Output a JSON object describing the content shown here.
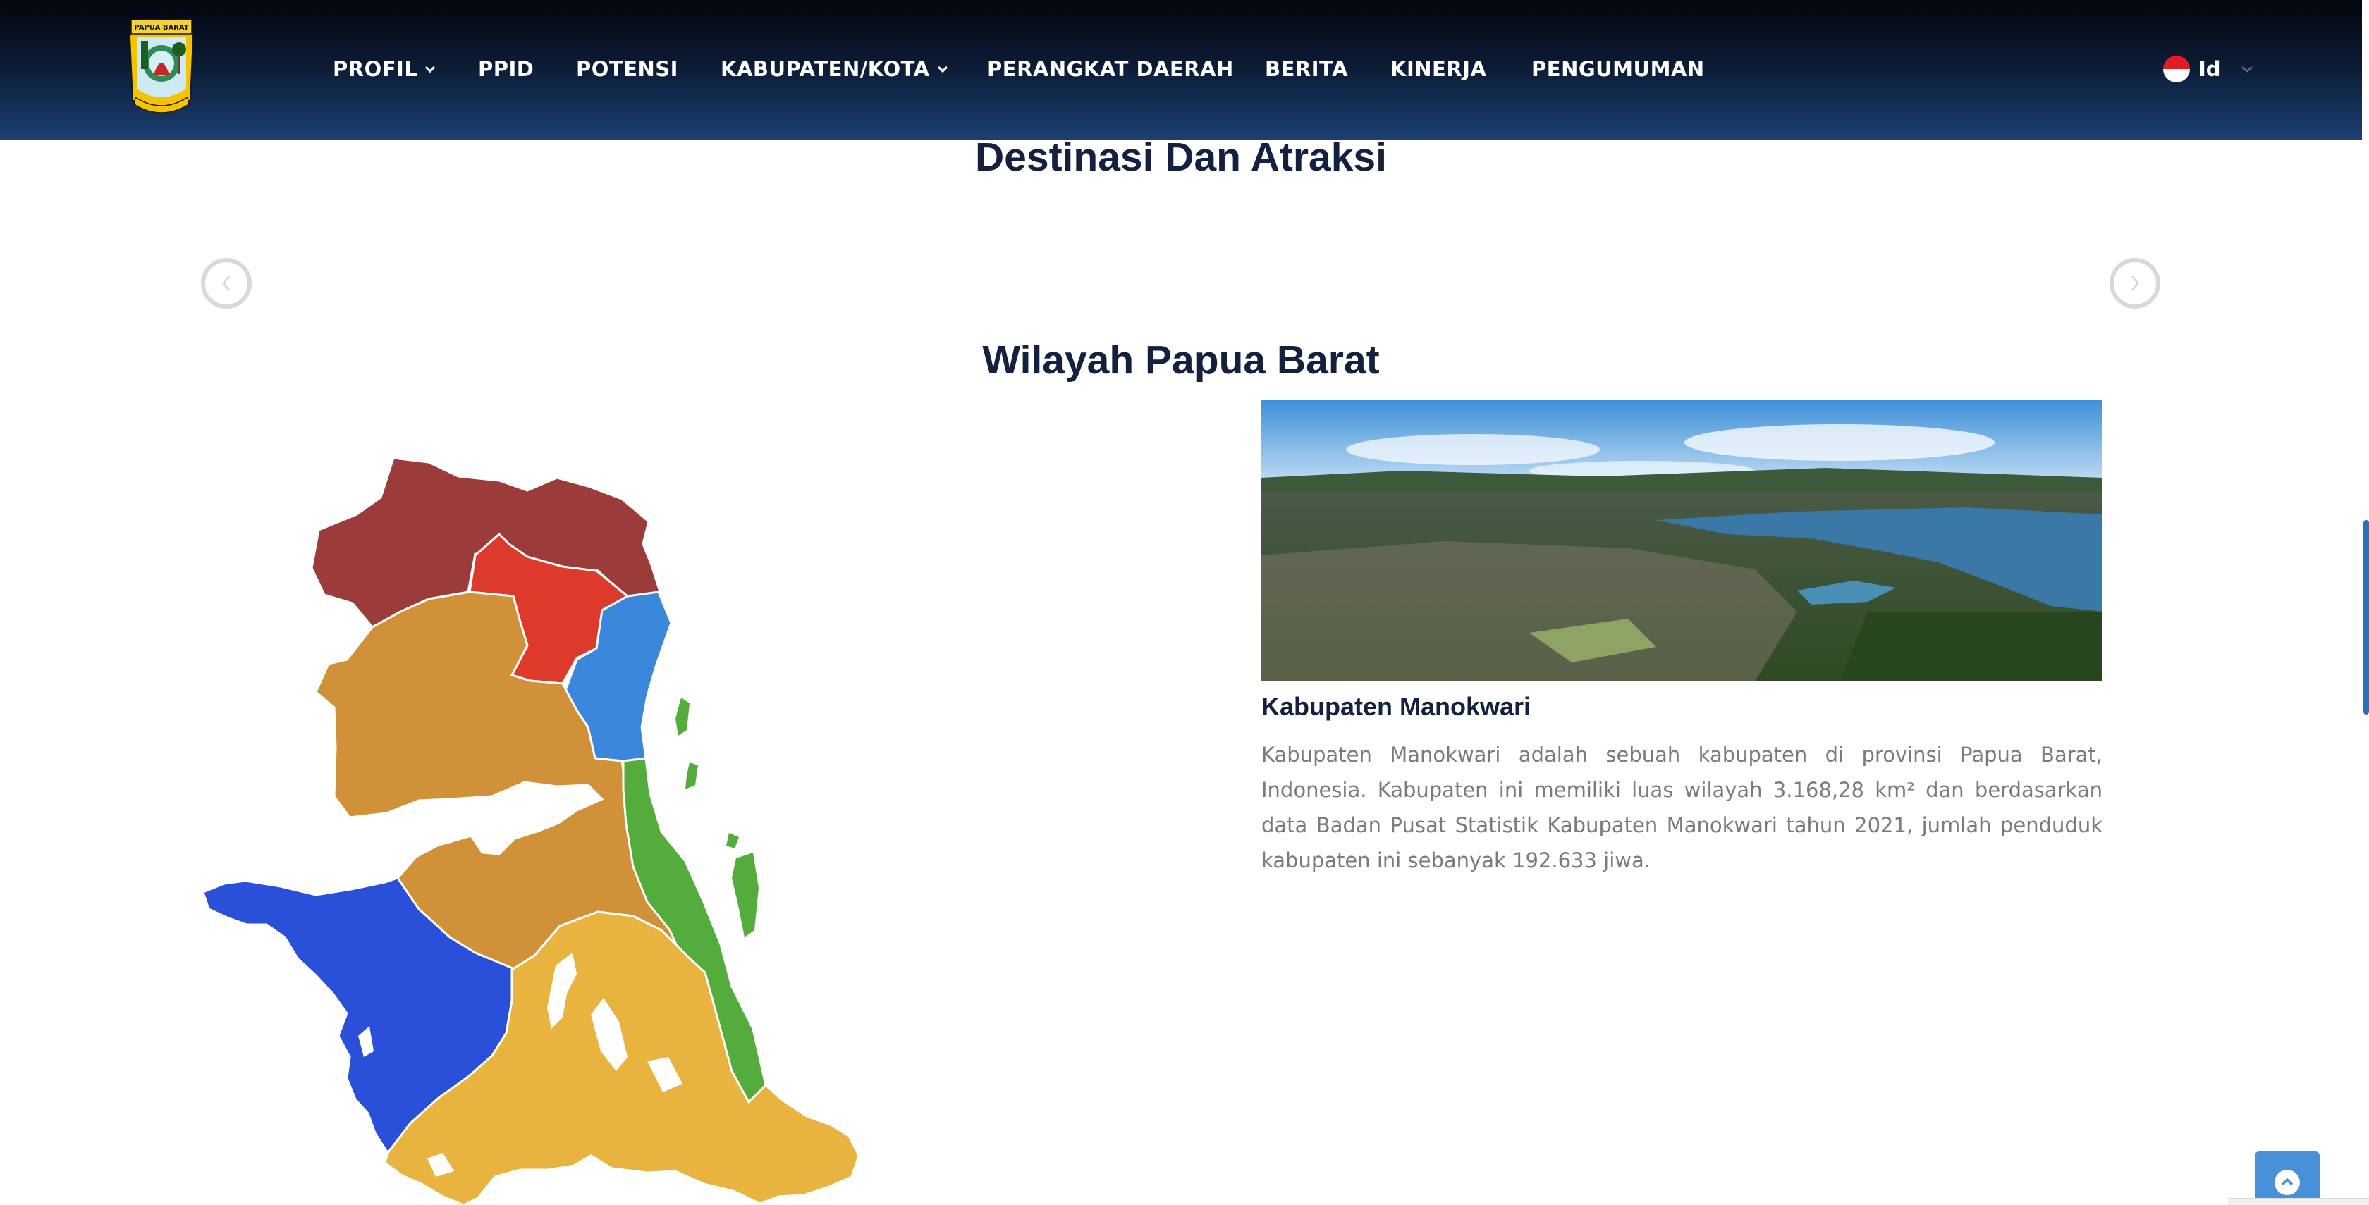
{
  "header": {
    "logo": {
      "icon": "papua-barat-emblem",
      "banner_text": "PAPUA BARAT"
    },
    "nav": [
      {
        "label": "PROFIL",
        "has_dropdown": true
      },
      {
        "label": "PPID",
        "has_dropdown": false
      },
      {
        "label": "POTENSI",
        "has_dropdown": false
      },
      {
        "label": "KABUPATEN/KOTA",
        "has_dropdown": true
      },
      {
        "label": "PERANGKAT DAERAH",
        "has_dropdown": false
      },
      {
        "label": "BERITA",
        "has_dropdown": false
      },
      {
        "label": "KINERJA",
        "has_dropdown": false
      },
      {
        "label": "PENGUMUMAN",
        "has_dropdown": false
      }
    ],
    "language": {
      "label": "Id",
      "icon": "indonesia-flag-icon"
    }
  },
  "destinations": {
    "title": "Destinasi Dan Atraksi",
    "prev_icon": "chevron-left-icon",
    "next_icon": "chevron-right-icon"
  },
  "region": {
    "title": "Wilayah Papua Barat",
    "map_icon": "papua-barat-region-map",
    "map_colors": [
      "#9b3c3a",
      "#de3a2b",
      "#3b87db",
      "#d09139",
      "#53ac3c",
      "#2a4fd9",
      "#e8b33f"
    ],
    "selected": {
      "name": "Kabupaten Manokwari",
      "description": "Kabupaten Manokwari adalah sebuah kabupaten di provinsi Papua Barat, Indonesia. Kabupaten ini memiliki luas wilayah 3.168,28 km² dan berdasarkan data Badan Pusat Statistik Kabupaten Manokwari tahun 2021, jumlah penduduk kabupaten ini sebanyak 192.633 jiwa.",
      "photo": "manokwari-aerial-photo"
    }
  },
  "colors": {
    "header_top": "#03060d",
    "header_bottom": "#1c3f72",
    "heading": "#14203f",
    "body_text": "#7b7b7b",
    "back_to_top": "#4a90d9"
  },
  "back_to_top_icon": "chevron-up-icon"
}
